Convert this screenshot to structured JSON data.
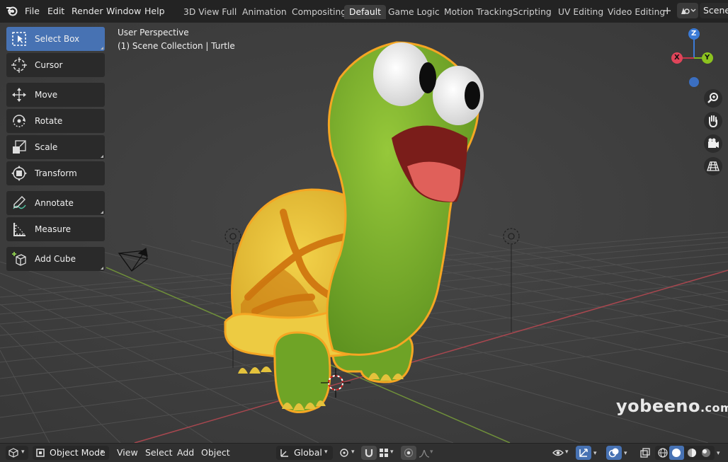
{
  "menu": {
    "file": "File",
    "edit": "Edit",
    "render": "Render",
    "window": "Window",
    "help": "Help"
  },
  "workspaces": [
    "3D View Full",
    "Animation",
    "Compositing",
    "Default",
    "Game Logic",
    "Motion Tracking",
    "Scripting",
    "UV Editing",
    "Video Editing"
  ],
  "active_workspace": "Default",
  "scene": {
    "name": "Scene"
  },
  "viewport": {
    "perspective": "User Perspective",
    "collection_info": "(1) Scene Collection | Turtle"
  },
  "toolbar": {
    "select_box": "Select Box",
    "cursor": "Cursor",
    "move": "Move",
    "rotate": "Rotate",
    "scale": "Scale",
    "transform": "Transform",
    "annotate": "Annotate",
    "measure": "Measure",
    "add_cube": "Add Cube"
  },
  "gizmo": {
    "z": "Z",
    "y": "Y",
    "x": "X"
  },
  "header": {
    "mode": "Object Mode",
    "view": "View",
    "select": "Select",
    "add": "Add",
    "object": "Object",
    "orientation": "Global"
  },
  "watermark": {
    "main": "yobeeno",
    "suffix": ".com"
  },
  "colors": {
    "accent": "#4772b3",
    "selection_outline": "#f5a623",
    "turtle_body": "#7ab22a",
    "turtle_shell": "#e8c23a"
  }
}
